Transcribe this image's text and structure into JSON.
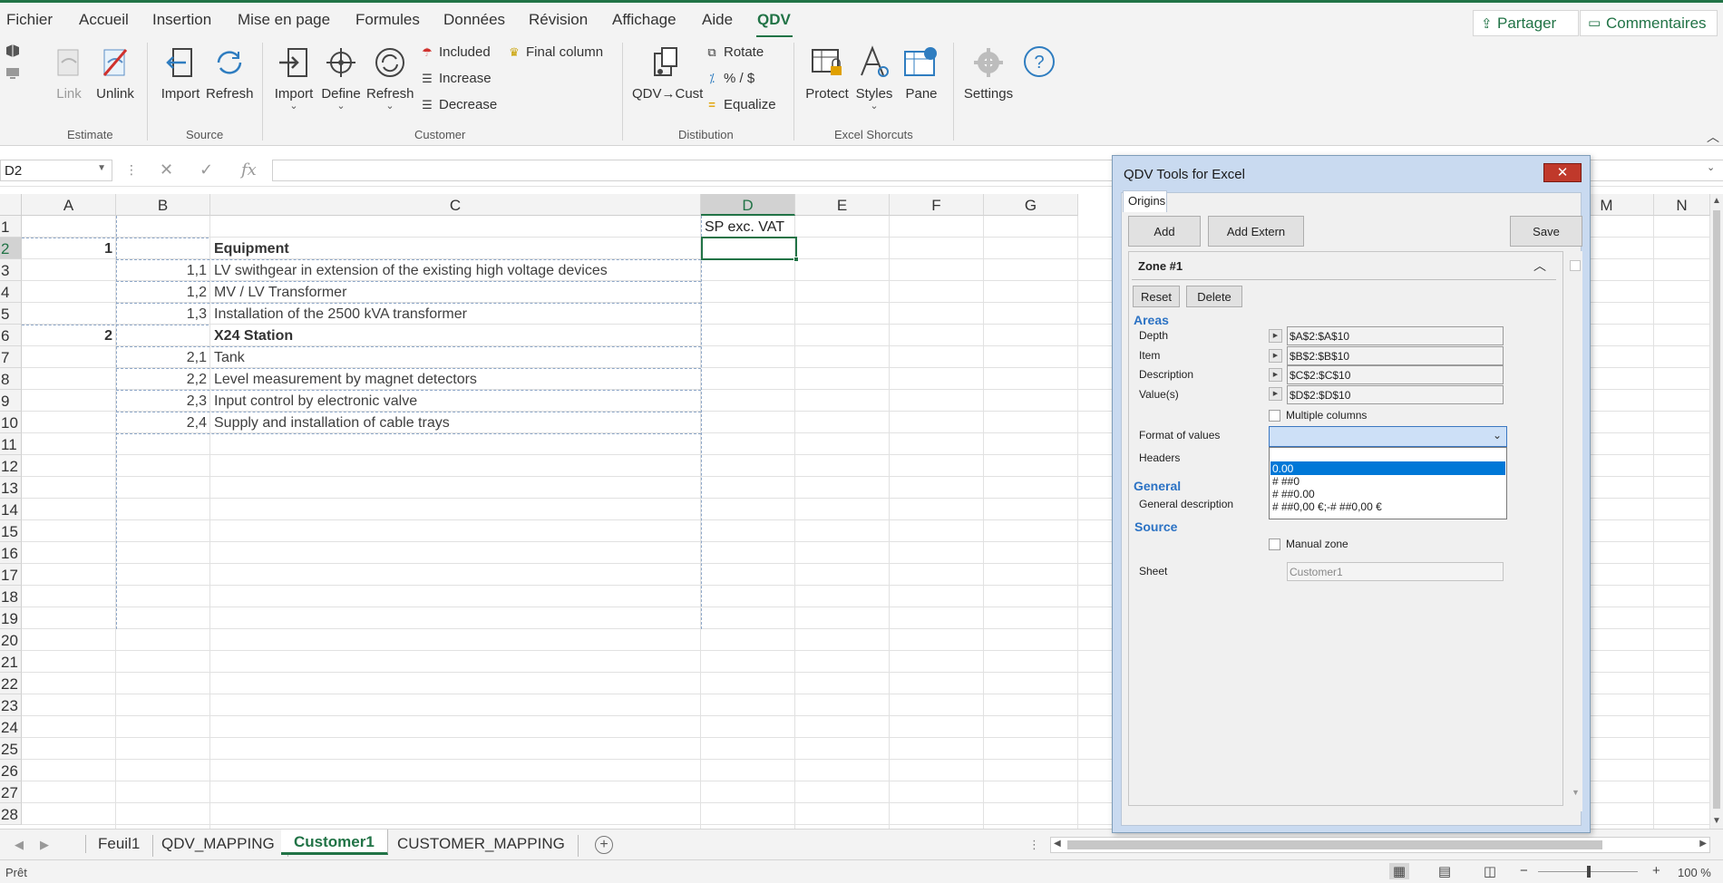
{
  "ribbon_tabs": [
    "Fichier",
    "Accueil",
    "Insertion",
    "Mise en page",
    "Formules",
    "Données",
    "Révision",
    "Affichage",
    "Aide",
    "QDV"
  ],
  "active_tab": "QDV",
  "share_label": "Partager",
  "comments_label": "Commentaires",
  "ribbon": {
    "estimate": {
      "label": "Estimate",
      "link": "Link",
      "unlink": "Unlink"
    },
    "source": {
      "label": "Source",
      "import": "Import",
      "refresh": "Refresh"
    },
    "customer": {
      "label": "Customer",
      "import": "Import",
      "define": "Define",
      "refresh": "Refresh",
      "included": "Included",
      "increase": "Increase",
      "decrease": "Decrease",
      "final_column": "Final column"
    },
    "distribution": {
      "label": "Distibution",
      "qdv_cust": "QDV→Cust",
      "rotate": "Rotate",
      "pct": "% / $",
      "equalize": "Equalize"
    },
    "excel": {
      "label": "Excel Shorcuts",
      "protect": "Protect",
      "styles": "Styles",
      "pane": "Pane"
    },
    "settings": "Settings"
  },
  "formula_bar": {
    "name_box": "D2",
    "cancel": "✕",
    "enter": "✓",
    "fx": "fx",
    "value": ""
  },
  "columns": [
    "A",
    "B",
    "C",
    "D",
    "E",
    "F",
    "G",
    "M",
    "N"
  ],
  "rows": [
    "1",
    "2",
    "3",
    "4",
    "5",
    "6",
    "7",
    "8",
    "9",
    "10",
    "11",
    "12",
    "13",
    "14",
    "15",
    "16",
    "17",
    "18",
    "19",
    "20",
    "21",
    "22",
    "23",
    "24",
    "25",
    "26",
    "27",
    "28"
  ],
  "cells": {
    "d1": "SP exc. VAT",
    "a2": "1",
    "c2": "Equipment",
    "b3": "1,1",
    "c3": "LV swithgear in extension of the existing high voltage devices",
    "b4": "1,2",
    "c4": "MV / LV Transformer",
    "b5": "1,3",
    "c5": "Installation of the 2500 kVA transformer",
    "a6": "2",
    "c6": "X24 Station",
    "b7": "2,1",
    "c7": "Tank",
    "b8": "2,2",
    "c8": "Level measurement by magnet detectors",
    "b9": "2,3",
    "c9": "Input control by electronic valve",
    "b10": "2,4",
    "c10": "Supply and installation of cable trays"
  },
  "sheets": [
    "Feuil1",
    "QDV_MAPPING",
    "Customer1",
    "CUSTOMER_MAPPING"
  ],
  "active_sheet": "Customer1",
  "status": "Prêt",
  "zoom": "100 %",
  "dialog": {
    "title": "QDV Tools for Excel",
    "tab": "Origins",
    "add": "Add",
    "add_extern": "Add Extern",
    "save": "Save",
    "zone_title": "Zone #1",
    "reset": "Reset",
    "delete": "Delete",
    "areas": "Areas",
    "depth_label": "Depth",
    "depth_value": "$A$2:$A$10",
    "item_label": "Item",
    "item_value": "$B$2:$B$10",
    "desc_label": "Description",
    "desc_value": "$C$2:$C$10",
    "values_label": "Value(s)",
    "values_value": "$D$2:$D$10",
    "multiple_columns": "Multiple columns",
    "format_label": "Format of values",
    "format_options": [
      "0.00",
      "# ##0",
      "# ##0.00",
      "# ##0,00 €;-# ##0,00 €"
    ],
    "headers_label": "Headers",
    "general": "General",
    "general_desc": "General description",
    "source": "Source",
    "manual_zone": "Manual zone",
    "sheet_label": "Sheet",
    "sheet_value": "Customer1"
  }
}
